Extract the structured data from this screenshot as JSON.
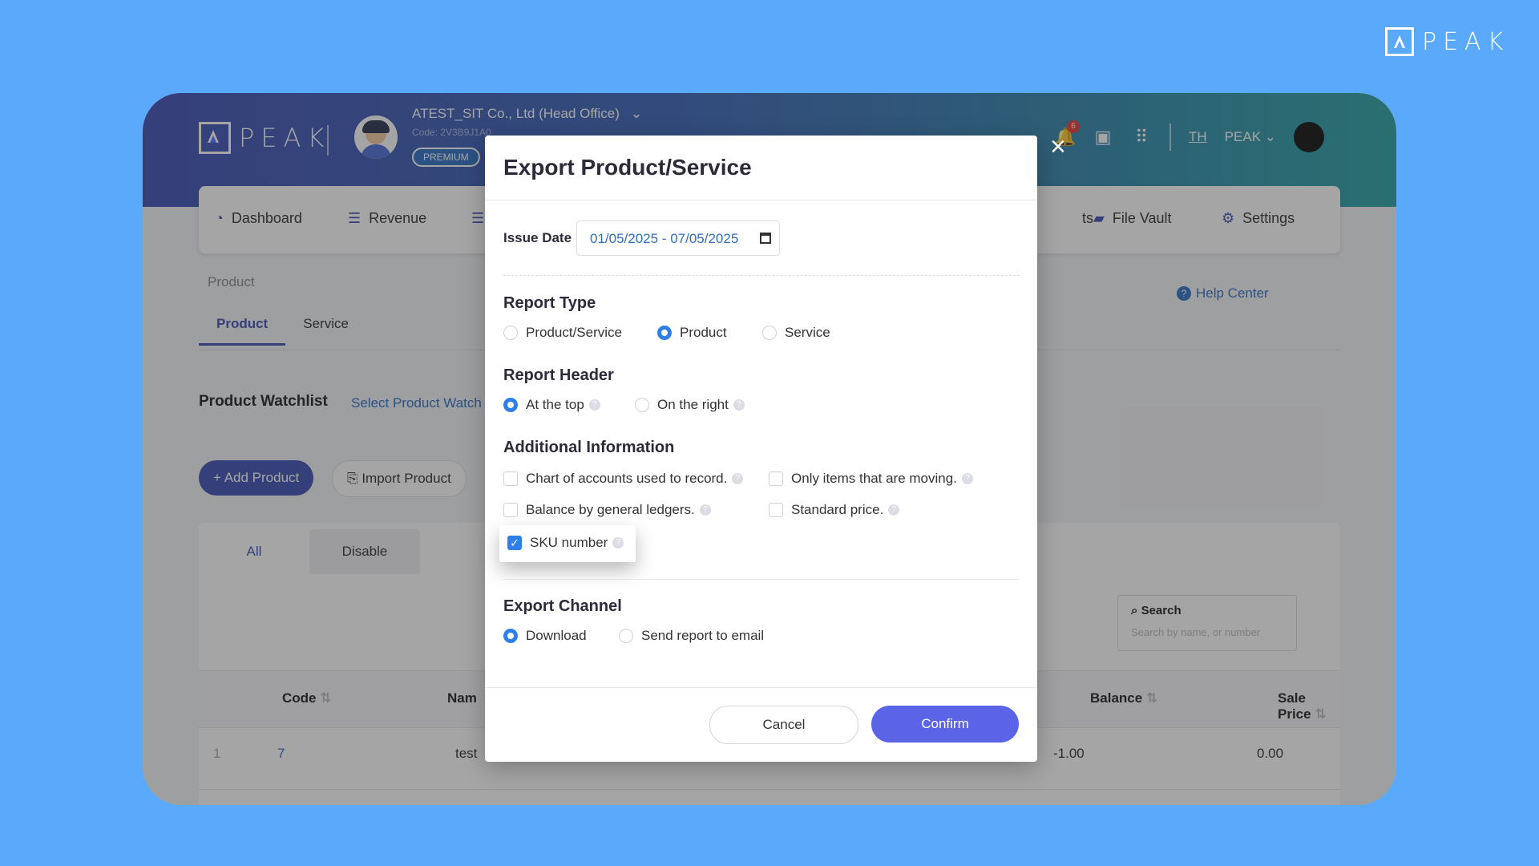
{
  "brand": {
    "text": "PEAK"
  },
  "header": {
    "company_name": "ATEST_SIT Co., Ltd (Head Office)",
    "company_code": "Code: 2V3B9J1A0",
    "plan_badge": "PREMIUM",
    "notification_count": "6",
    "language": "TH",
    "user_name": "PEAK"
  },
  "nav": {
    "dashboard": "Dashboard",
    "revenue": "Revenue",
    "partial_reports": "ts",
    "file_vault": "File Vault",
    "settings": "Settings"
  },
  "page": {
    "breadcrumb": "Product",
    "tabs": [
      "Product",
      "Service"
    ],
    "help_center": "Help Center",
    "watchlist_title": "Product Watchlist",
    "watchlist_link": "Select Product Watch",
    "add_product": "+ Add Product",
    "import_product": "Import Product",
    "sub_tabs": [
      "All",
      "Disable"
    ],
    "search_label": "Search",
    "search_placeholder": "Search by name, or number",
    "table": {
      "headers": {
        "code": "Code",
        "name": "Nam",
        "balance": "Balance",
        "sale_price": "Sale Price"
      },
      "rows": [
        {
          "index": "1",
          "code": "7",
          "name": "test",
          "balance": "-1.00",
          "sale_price": "0.00"
        }
      ]
    }
  },
  "modal": {
    "title": "Export Product/Service",
    "close_symbol": "×",
    "issue_date_label": "Issue Date",
    "issue_date_value": "01/05/2025 - 07/05/2025",
    "report_type": {
      "title": "Report Type",
      "options": [
        "Product/Service",
        "Product",
        "Service"
      ],
      "selected": "Product"
    },
    "report_header": {
      "title": "Report Header",
      "options": [
        "At the top",
        "On the right"
      ],
      "selected": "At the top"
    },
    "additional_info": {
      "title": "Additional Information",
      "options": [
        {
          "label": "Chart of accounts used to record.",
          "checked": false
        },
        {
          "label": "Only items that are moving.",
          "checked": false
        },
        {
          "label": "Balance by general ledgers.",
          "checked": false
        },
        {
          "label": "Standard price.",
          "checked": false
        },
        {
          "label": "SKU number",
          "checked": true
        }
      ]
    },
    "export_channel": {
      "title": "Export Channel",
      "options": [
        "Download",
        "Send report to email"
      ],
      "selected": "Download"
    },
    "cancel_label": "Cancel",
    "confirm_label": "Confirm"
  },
  "colors": {
    "background": "#5aa9fa",
    "header_start": "#3f51b5",
    "header_end": "#2aa3a6",
    "primary": "#3f51b5",
    "radio_active": "#2f7fe8",
    "confirm_button": "#5b63e6"
  }
}
